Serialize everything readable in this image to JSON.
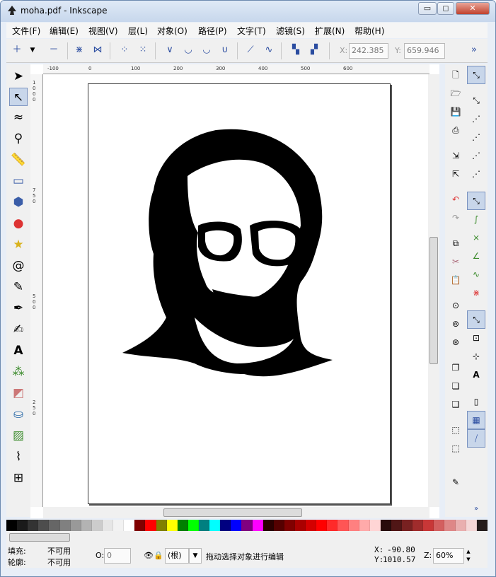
{
  "window": {
    "title": "moha.pdf - Inkscape",
    "min_label": "▭",
    "max_label": "◻",
    "close_label": "✕"
  },
  "menu": [
    {
      "label": "文件(F)"
    },
    {
      "label": "编辑(E)"
    },
    {
      "label": "视图(V)"
    },
    {
      "label": "层(L)"
    },
    {
      "label": "对象(O)"
    },
    {
      "label": "路径(P)"
    },
    {
      "label": "文字(T)"
    },
    {
      "label": "滤镜(S)"
    },
    {
      "label": "扩展(N)"
    },
    {
      "label": "帮助(H)"
    }
  ],
  "commands": {
    "x_label": "X:",
    "x_value": "242.385",
    "y_label": "Y:",
    "y_value": "659.946",
    "more_label": "»"
  },
  "hruler": [
    "-100",
    "0",
    "100",
    "200",
    "300",
    "400",
    "500",
    "600"
  ],
  "vruler": [
    "1 0 0 0",
    "7 5 0",
    "5 0 0",
    "2 5 0"
  ],
  "status": {
    "fill_label": "填充:",
    "fill_value": "不可用",
    "stroke_label": "轮廓:",
    "stroke_value": "不可用",
    "opacity_label": "O:",
    "opacity_value": "0",
    "layer_value": "(根)",
    "message": "拖动选择对象进行编辑",
    "x_label": "X:",
    "x_value": "-90.80",
    "y_label": "Y:",
    "y_value": "1010.57",
    "zoom_label": "Z:",
    "zoom_value": "60%"
  },
  "palette": [
    "#000000",
    "#1a1a1a",
    "#333333",
    "#4d4d4d",
    "#666666",
    "#808080",
    "#999999",
    "#b3b3b3",
    "#cccccc",
    "#e6e6e6",
    "#f2f2f2",
    "#ffffff",
    "#800000",
    "#ff0000",
    "#808000",
    "#ffff00",
    "#008000",
    "#00ff00",
    "#008080",
    "#00ffff",
    "#000080",
    "#0000ff",
    "#800080",
    "#ff00ff",
    "#2b0000",
    "#550000",
    "#800000",
    "#aa0000",
    "#d40000",
    "#ff0000",
    "#ff2a2a",
    "#ff5555",
    "#ff8080",
    "#ffaaaa",
    "#ffd5d5",
    "#280b0b",
    "#501616",
    "#782121",
    "#a02c2c",
    "#c83737",
    "#d35f5f",
    "#de8787",
    "#e9afaf",
    "#f4d7d7",
    "#241c1c"
  ],
  "icons": {
    "app": "inkscape-logo-icon"
  }
}
